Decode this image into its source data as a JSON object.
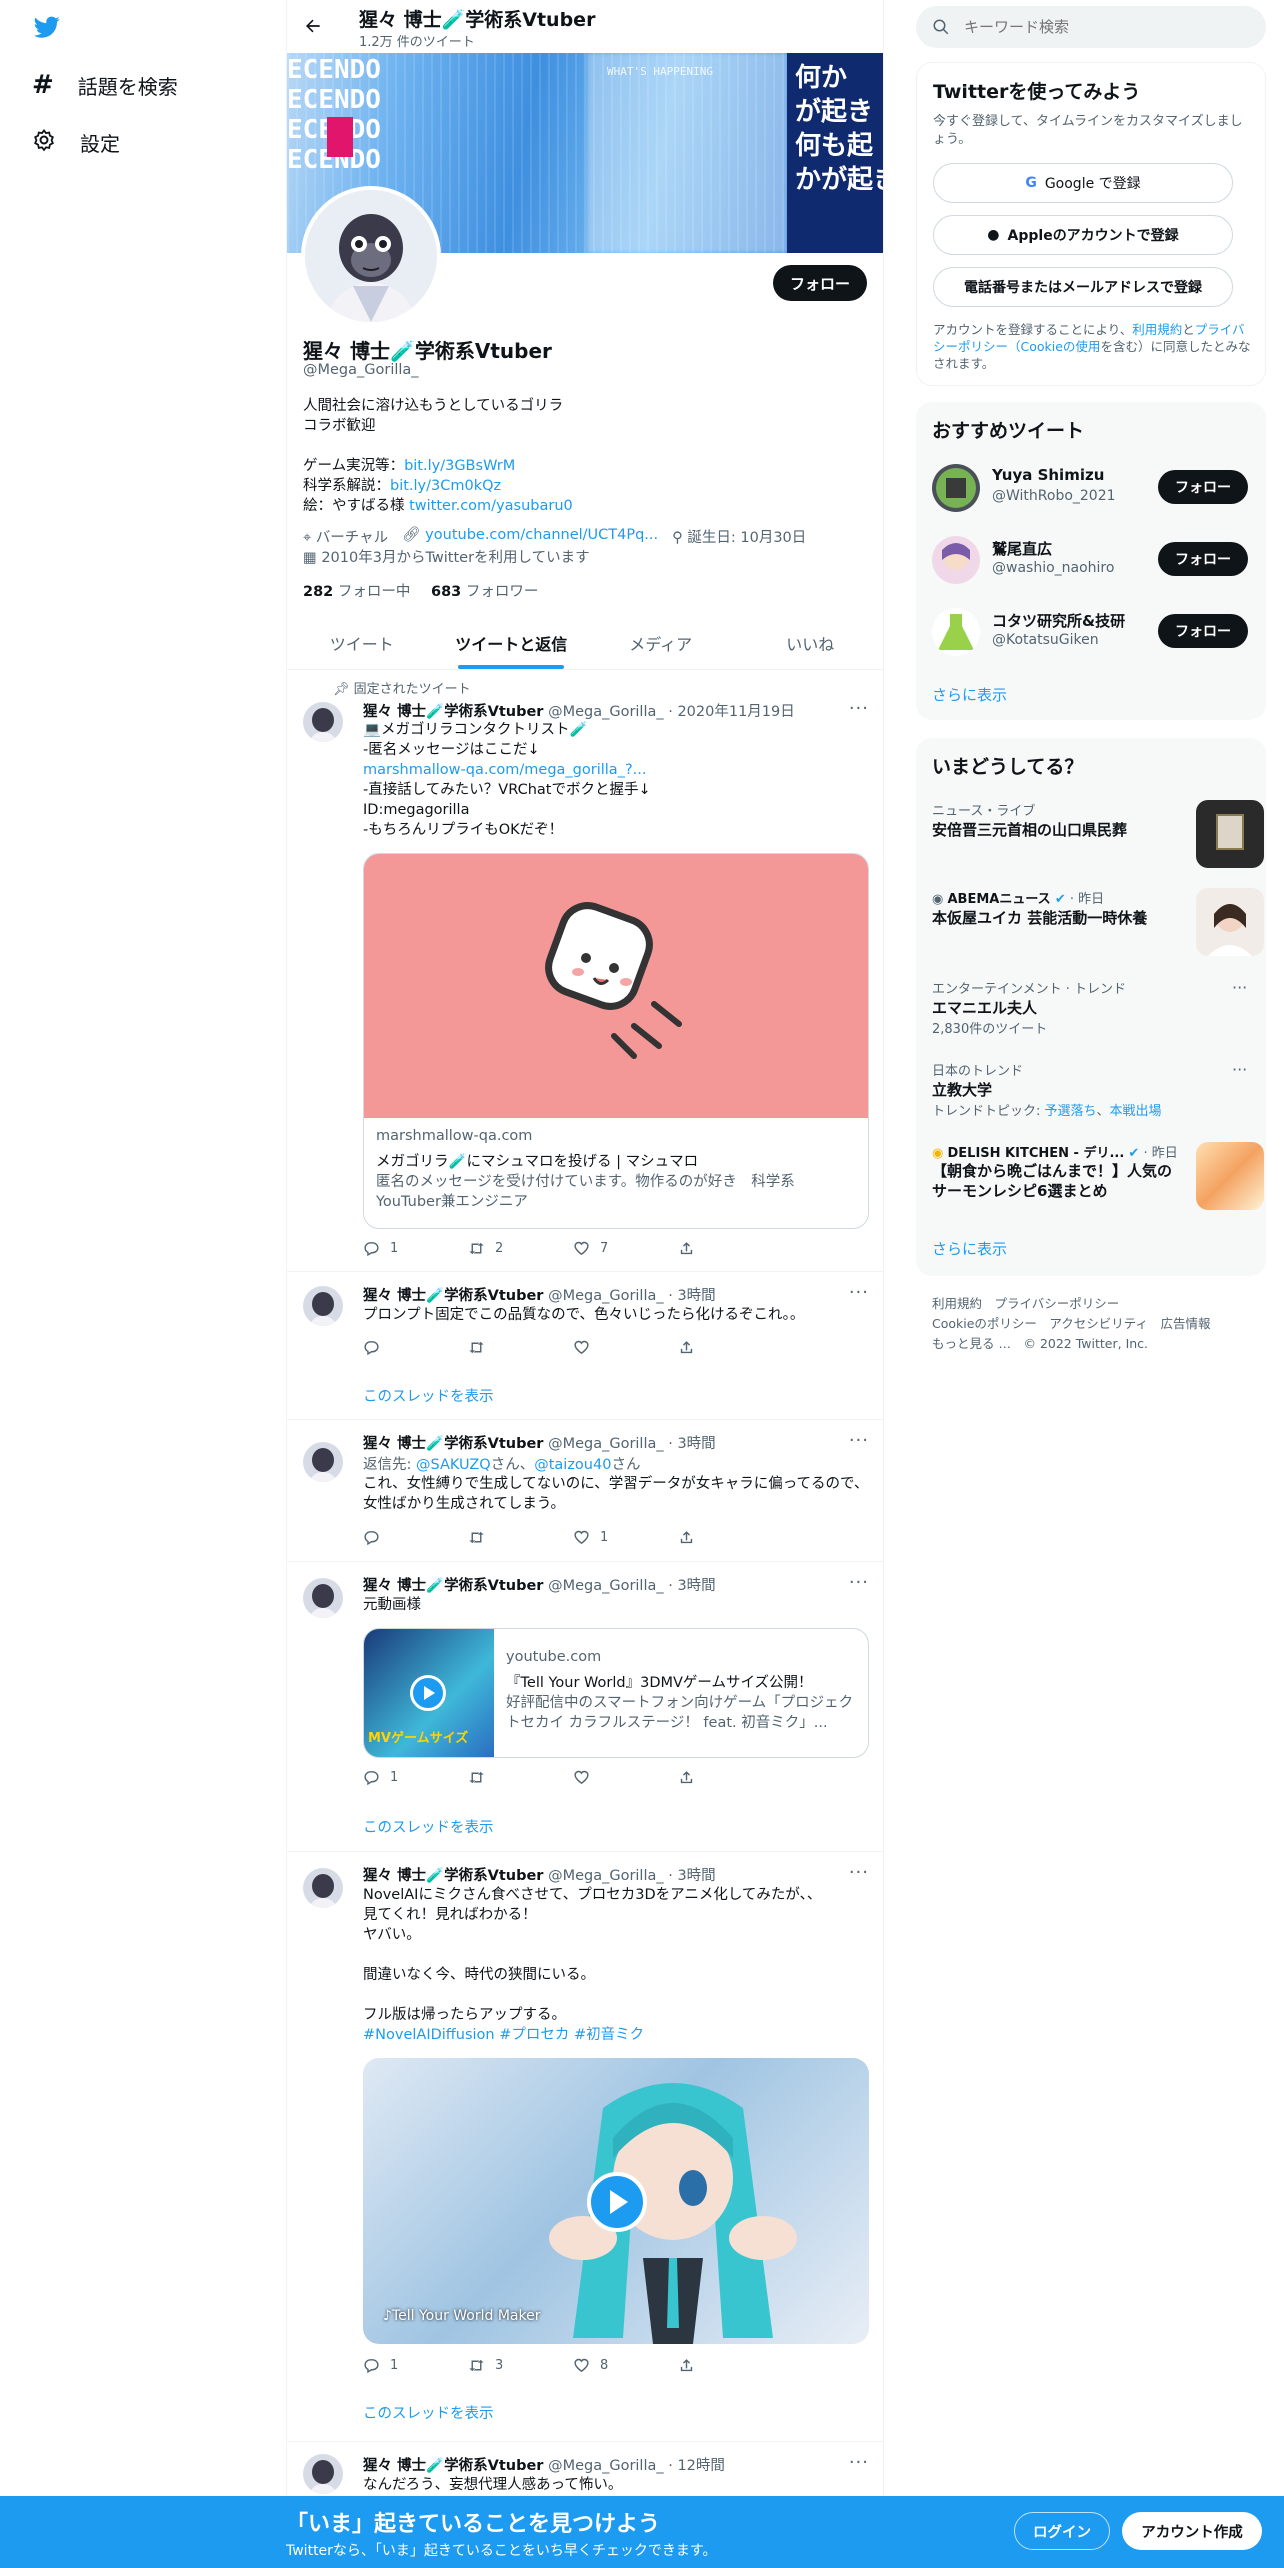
{
  "nav": {
    "explore": "話題を検索",
    "settings": "設定"
  },
  "profile_header": {
    "name": "猩々 博士🧪学術系Vtuber",
    "tweet_count": "1.2万 件のツイート"
  },
  "banner": {
    "lines": [
      "ECENDO",
      "ECENDO",
      "ECENDO",
      "ECENDO",
      "何か",
      "が起き",
      "何も起",
      "かが起き"
    ],
    "small_text": "WHAT'S HAPPENING"
  },
  "profile": {
    "follow_label": "フォロー",
    "display_name": "猩々 博士🧪学術系Vtuber",
    "handle": "@Mega_Gorilla_",
    "bio_line1": "人間社会に溶け込もうとしているゴリラ",
    "bio_line2": "コラボ歓迎",
    "game_label": "ゲーム実況等：",
    "game_link": "bit.ly/3GBsWrM",
    "science_label": "科学系解説：",
    "science_link": "bit.ly/3Cm0kQz",
    "art_label": "絵：やすばる様 ",
    "art_link": "twitter.com/yasubaru0",
    "location": "バーチャル",
    "url": "youtube.com/channel/UCT4Pq...",
    "birthday": "誕生日: 10月30日",
    "joined": "2010年3月からTwitterを利用しています",
    "following_count": "282",
    "following_label": " フォロー中",
    "followers_count": "683",
    "followers_label": " フォロワー"
  },
  "tabs": [
    "ツイート",
    "ツイートと返信",
    "メディア",
    "いいね"
  ],
  "tweets": [
    {
      "pinned_label": "固定されたツイート",
      "name": "猩々 博士🧪学術系Vtuber",
      "handle": "@Mega_Gorilla_",
      "time": "· 2020年11月19日",
      "lines": [
        "💻メガゴリラコンタクトリスト🧪",
        "-匿名メッセージはここだ↓"
      ],
      "link": "marshmallow-qa.com/mega_gorilla_?...",
      "lines2": [
        "-直接話してみたい？VRChatでボクと握手↓",
        "ID:megagorilla",
        "-もちろんリプライもOKだぞ！"
      ],
      "card": {
        "domain": "marshmallow-qa.com",
        "title": "メガゴリラ🧪にマシュマロを投げる | マシュマロ",
        "desc": "匿名のメッセージを受け付けています。物作るのが好き　科学系YouTuber兼エンジニア",
        "bg": "#f49797"
      },
      "replies": "1",
      "retweets": "2",
      "likes": "7"
    },
    {
      "name": "猩々 博士🧪学術系Vtuber",
      "handle": "@Mega_Gorilla_",
      "time": "· 3時間",
      "text": "プロンプト固定でこの品質なので、色々いじったら化けるぞこれ。。",
      "replies": "",
      "retweets": "",
      "likes": "",
      "thread": "このスレッドを表示"
    },
    {
      "name": "猩々 博士🧪学術系Vtuber",
      "handle": "@Mega_Gorilla_",
      "time": "· 3時間",
      "reply_prefix": "返信先: ",
      "reply_to1": "@SAKUZQ",
      "reply_mid": "さん、",
      "reply_to2": "@taizou40",
      "reply_suffix": "さん",
      "text1": "これ、女性縛りで生成してないのに、学習データが女キャラに偏ってるので、女性ばかり生成されてしまう。",
      "replies": "",
      "retweets": "",
      "likes": "1"
    },
    {
      "name": "猩々 博士🧪学術系Vtuber",
      "handle": "@Mega_Gorilla_",
      "time": "· 3時間",
      "text": "元動画様",
      "card": {
        "domain": "youtube.com",
        "title": "『Tell Your World』3DMVゲームサイズ公開！",
        "desc": "好評配信中のスマートフォン向けゲーム「プロジェクトセカイ カラフルステージ！ feat. 初音ミク」...",
        "thumb_caption": "MVゲームサイズ"
      },
      "replies": "1",
      "retweets": "",
      "likes": "",
      "thread": "このスレッドを表示"
    },
    {
      "name": "猩々 博士🧪学術系Vtuber",
      "handle": "@Mega_Gorilla_",
      "time": "· 3時間",
      "lines": [
        "NovelAIにミクさん食べさせて、プロセカ3Dをアニメ化してみたが、、",
        "見てくれ！見ればわかる！",
        "ヤバい。",
        "",
        "間違いなく今、時代の狭間にいる。",
        "",
        "フル版は帰ったらアップする。"
      ],
      "hashtags": "#NovelAIDiffusion #プロセカ #初音ミク",
      "video_caption": "♪Tell Your World  Maker",
      "replies": "1",
      "retweets": "3",
      "likes": "8",
      "thread": "このスレッドを表示"
    },
    {
      "name": "猩々 博士🧪学術系Vtuber",
      "handle": "@Mega_Gorilla_",
      "time": "· 12時間",
      "text": "なんだろう、妄想代理人感あって怖い。"
    }
  ],
  "search": {
    "placeholder": "キーワード検索"
  },
  "signup": {
    "title": "Twitterを使ってみよう",
    "subtitle": "今すぐ登録して、タイムラインをカスタマイズしましょう。",
    "google": "Google で登録",
    "apple": "Appleのアカウントで登録",
    "phone": "電話番号またはメールアドレスで登録",
    "terms_pre": "アカウントを登録することにより、",
    "terms_link": "利用規約",
    "terms_mid": "と",
    "privacy_link": "プライバシーポリシー（Cookieの使用",
    "terms_post": "を含む）に同意したとみなされます。"
  },
  "recommended": {
    "title": "おすすめツイート",
    "users": [
      {
        "name": "Yuya Shimizu",
        "handle": "@WithRobo_2021",
        "follow": "フォロー"
      },
      {
        "name": "鷲尾直広",
        "handle": "@washio_naohiro",
        "follow": "フォロー"
      },
      {
        "name": "コタツ研究所&技研",
        "handle": "@KotatsuGiken",
        "follow": "フォロー"
      }
    ],
    "more": "さらに表示"
  },
  "trends": {
    "title": "いまどうしてる？",
    "items": [
      {
        "meta": "ニュース・ライブ",
        "title": "安倍晋三元首相の山口県民葬"
      },
      {
        "meta": "ABEMAニュース",
        "meta2": " · 昨日",
        "title": "本仮屋ユイカ 芸能活動一時休養"
      },
      {
        "meta": "エンターテインメント · トレンド",
        "title": "エマニエル夫人",
        "count": "2,830件のツイート"
      },
      {
        "meta": "日本のトレンド",
        "title": "立教大学",
        "topic_pre": "トレンドトピック: ",
        "topic1": "予選落ち",
        "topic_sep": "、",
        "topic2": "本戦出場"
      },
      {
        "meta": "DELISH KITCHEN - デリ...",
        "meta2": " · 昨日",
        "title": "【朝食から晩ごはんまで！】人気のサーモンレシピ6選まとめ"
      }
    ],
    "more": "さらに表示"
  },
  "footer": {
    "links1": "利用規約　プライバシーポリシー",
    "links2": "Cookieのポリシー　アクセシビリティ　広告情報",
    "links3": "もっと見る …　© 2022 Twitter, Inc."
  },
  "bottom": {
    "title": "「いま」起きていることを見つけよう",
    "subtitle": "Twitterなら、「いま」起きていることをいち早くチェックできます。",
    "login": "ログイン",
    "signup": "アカウント作成"
  },
  "colors": {
    "accent": "#1d9bf0",
    "dark": "#0f1419",
    "muted": "#536471"
  }
}
